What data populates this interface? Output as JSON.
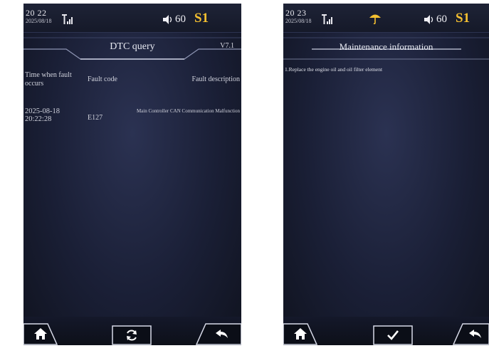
{
  "left_screen": {
    "status": {
      "time": "20 22",
      "date": "2025/08/18",
      "volume": "60",
      "gear": "S1"
    },
    "title": "DTC query",
    "version": "V7.1",
    "table": {
      "headers": [
        "Time when fault occurs",
        "Fault code",
        "Fault description"
      ],
      "rows": [
        {
          "time": "2025-08-18 20:22:28",
          "code": "E127",
          "description": "Main Controller CAN Communication Malfunction"
        }
      ]
    },
    "buttons": [
      "home-icon",
      "refresh-icon",
      "back-icon"
    ]
  },
  "right_screen": {
    "status": {
      "time": "20 23",
      "date": "2025/08/18",
      "volume": "60",
      "gear": "S1"
    },
    "title": "Maintenance information",
    "items": [
      "1.Replace the engine oil and oil filter element"
    ],
    "buttons": [
      "home-icon",
      "check-icon",
      "back-icon"
    ]
  },
  "colors": {
    "gear": "#f5c030",
    "umbrella": "#f5c030",
    "background": "#1a1f36"
  }
}
